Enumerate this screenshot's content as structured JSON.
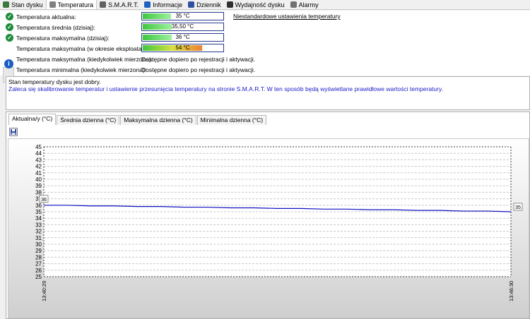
{
  "tabs": [
    {
      "label": "Stan dysku",
      "icon": "gear-icon",
      "color": "#3a7a3a"
    },
    {
      "label": "Temperatura",
      "icon": "thermometer-icon",
      "color": "#808080",
      "active": true
    },
    {
      "label": "S.M.A.R.T.",
      "icon": "smart-icon",
      "color": "#606060"
    },
    {
      "label": "Informacje",
      "icon": "info-icon",
      "color": "#2060c0"
    },
    {
      "label": "Dziennik",
      "icon": "log-icon",
      "color": "#3050a0"
    },
    {
      "label": "Wydajność dysku",
      "icon": "performance-icon",
      "color": "#303030"
    },
    {
      "label": "Alarmy",
      "icon": "alarm-icon",
      "color": "#707070"
    }
  ],
  "temps": [
    {
      "label": "Temperatura aktualna:",
      "value": "35 °C",
      "fraction": 0.35,
      "ok": true
    },
    {
      "label": "Temperatura średnia (dzisiaj):",
      "value": "35,50 °C",
      "fraction": 0.36,
      "ok": true
    },
    {
      "label": "Temperatura maksymalna (dzisiaj):",
      "value": "36 °C",
      "fraction": 0.36,
      "ok": true
    },
    {
      "label": "Temperatura maksymalna (w okresie eksploatacji):",
      "value": "54 °C",
      "fraction": 0.74,
      "ok": false
    }
  ],
  "custom_link": "Niestandardowe ustawienia temperatury",
  "extra": [
    {
      "label": "Temperatura maksymalna (kiedykolwiek mierzona):",
      "value": "Dostępne dopiero po rejestracji i aktywacji."
    },
    {
      "label": "Temperatura minimalna (kiedykolwiek mierzona):",
      "value": "Dostępne dopiero po rejestracji i aktywacji."
    }
  ],
  "status": {
    "line1": "Stan temperatury dysku jest dobry.",
    "line2": "Zaleca się skalibrowanie temperatur i ustawienie przesunięcia temperatury na stronie S.M.A.R.T. W ten sposób będą wyświetlane prawidłowe wartości temperatury."
  },
  "chart_tabs": [
    "Aktualna/y (°C)",
    "Średnia dzienna (°C)",
    "Maksymalna dzienna (°C)",
    "Minimalna dzienna (°C)"
  ],
  "colors": {
    "line": "#1010c0",
    "bar_green": "#3ec83e",
    "bar_orange": "#f08030",
    "check": "#1e8c3a"
  },
  "chart_data": {
    "type": "line",
    "x_labels": [
      "13:40:29",
      "13:46:30"
    ],
    "ylim": [
      25,
      45
    ],
    "yticks": [
      25,
      26,
      27,
      28,
      29,
      30,
      31,
      32,
      33,
      34,
      35,
      36,
      37,
      38,
      39,
      40,
      41,
      42,
      43,
      44,
      45
    ],
    "series": [
      {
        "values": [
          36,
          36,
          35.9,
          35.9,
          35.8,
          35.8,
          35.7,
          35.7,
          35.6,
          35.6,
          35.5,
          35.5,
          35.4,
          35.4,
          35.3,
          35.3,
          35.2,
          35.2,
          35.1,
          35.1,
          35.0
        ]
      }
    ],
    "start_label": "36",
    "end_label": "35",
    "grid": true
  }
}
